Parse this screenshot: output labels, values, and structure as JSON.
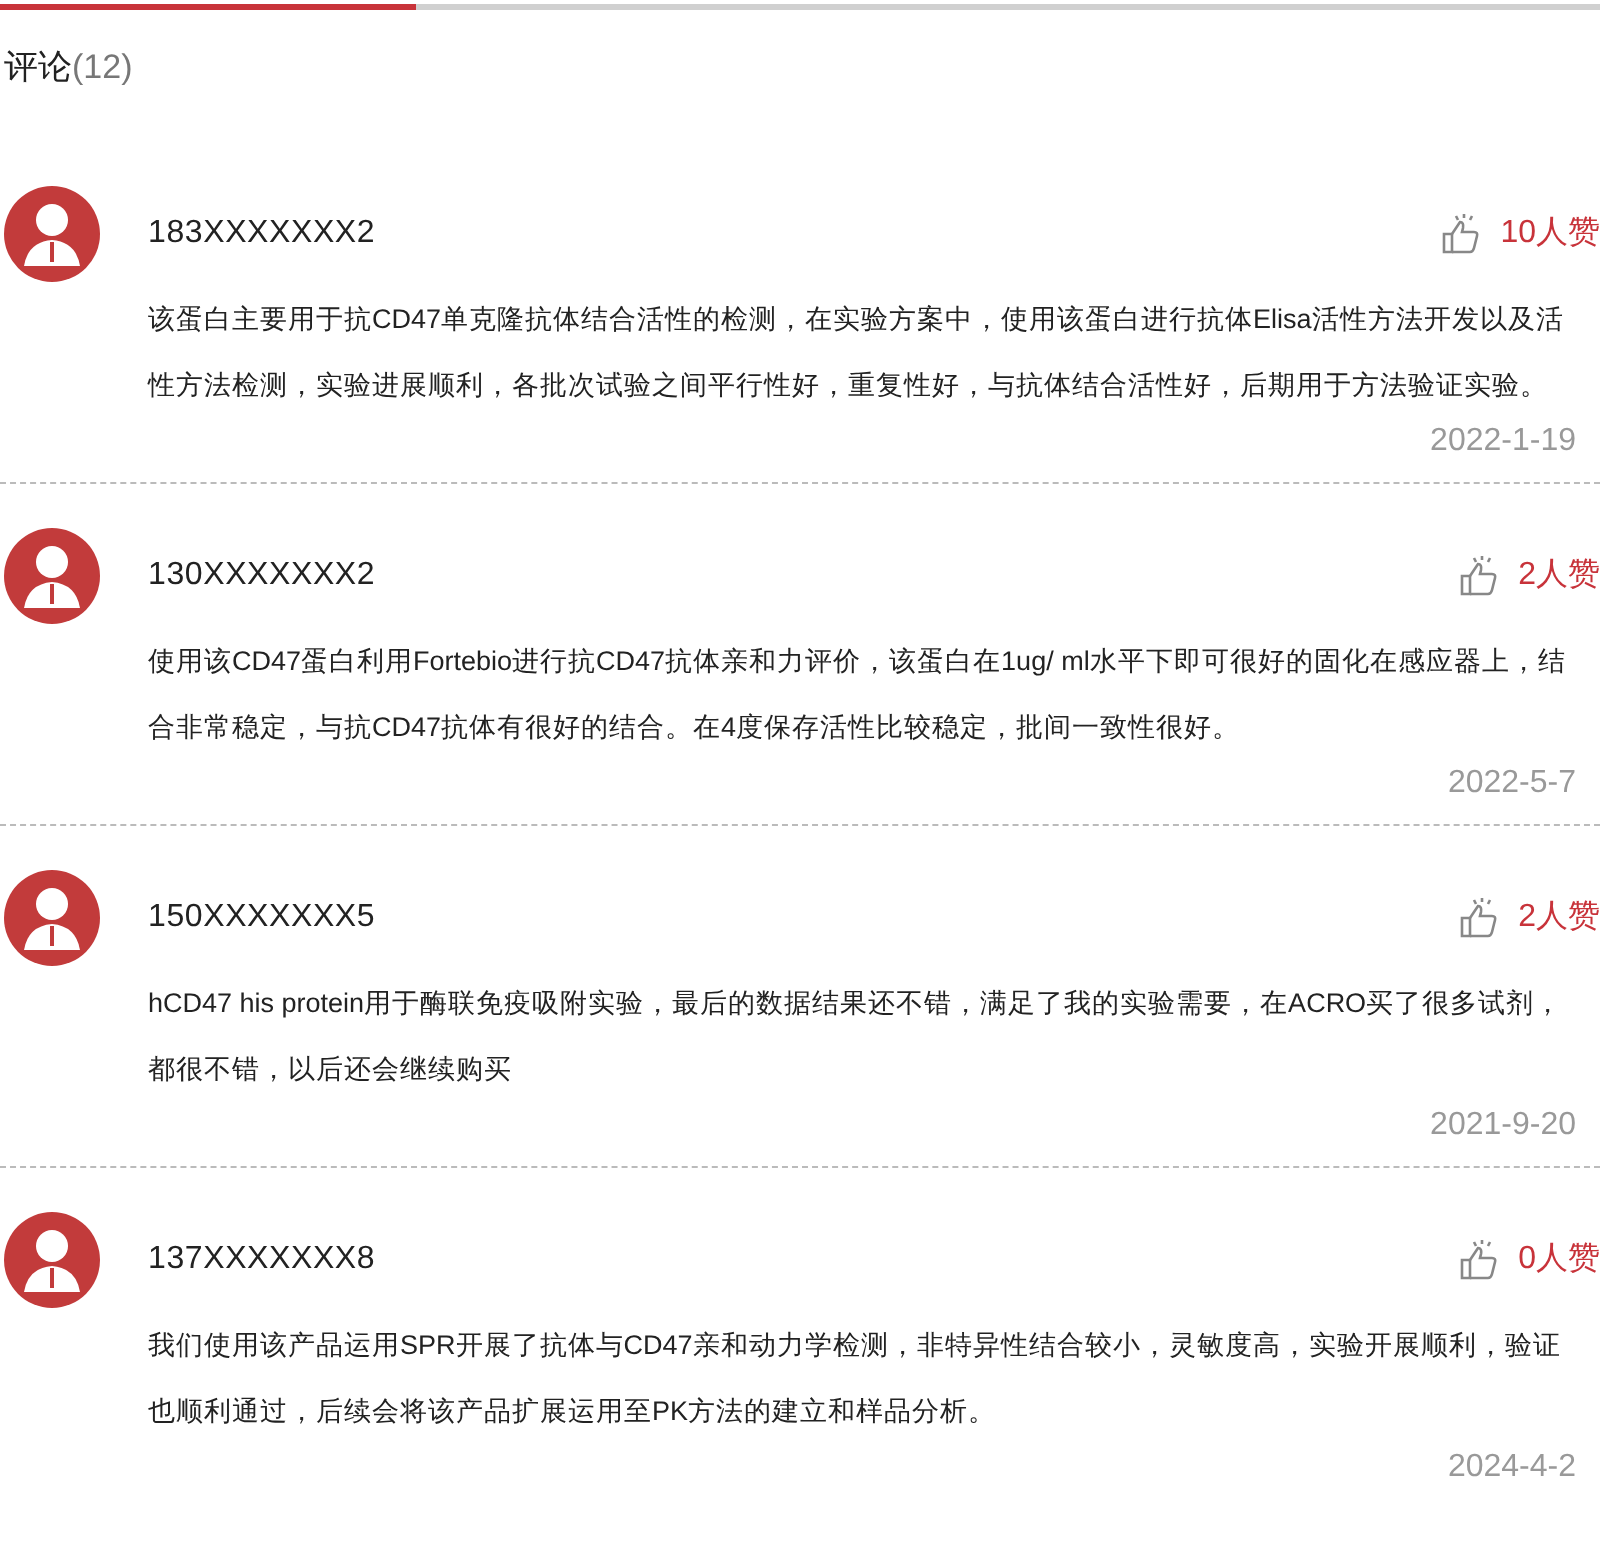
{
  "tab_indicator": {
    "level": 0.26
  },
  "heading": {
    "title": "评论",
    "count": "(12)"
  },
  "comments": [
    {
      "user": "183XXXXXXX2",
      "likes": "10人赞",
      "text": "该蛋白主要用于抗CD47单克隆抗体结合活性的检测，在实验方案中，使用该蛋白进行抗体Elisa活性方法开发以及活性方法检测，实验进展顺利，各批次试验之间平行性好，重复性好，与抗体结合活性好，后期用于方法验证实验。",
      "date": "2022-1-19"
    },
    {
      "user": "130XXXXXXX2",
      "likes": "2人赞",
      "text": "使用该CD47蛋白利用Fortebio进行抗CD47抗体亲和力评价，该蛋白在1ug/ ml水平下即可很好的固化在感应器上，结合非常稳定，与抗CD47抗体有很好的结合。在4度保存活性比较稳定，批间一致性很好。",
      "date": "2022-5-7"
    },
    {
      "user": "150XXXXXXX5",
      "likes": "2人赞",
      "text": "hCD47 his protein用于酶联免疫吸附实验，最后的数据结果还不错，满足了我的实验需要，在ACRO买了很多试剂，都很不错，以后还会继续购买",
      "date": "2021-9-20"
    },
    {
      "user": "137XXXXXXX8",
      "likes": "0人赞",
      "text": "我们使用该产品运用SPR开展了抗体与CD47亲和动力学检测，非特异性结合较小，灵敏度高，实验开展顺利，验证也顺利通过，后续会将该产品扩展运用至PK方法的建立和样品分析。",
      "date": "2024-4-2"
    }
  ]
}
